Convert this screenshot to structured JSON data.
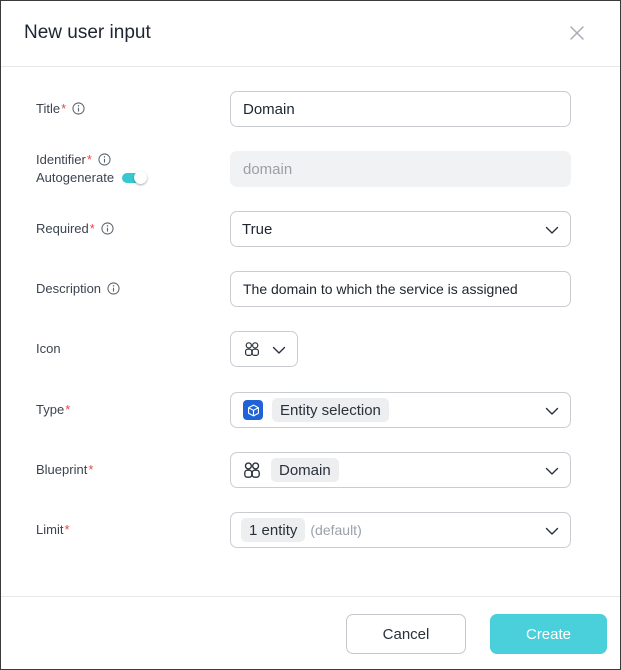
{
  "dialog": {
    "title": "New user input",
    "cancel_label": "Cancel",
    "create_label": "Create"
  },
  "fields": {
    "title": {
      "label": "Title",
      "required": "*",
      "value": "Domain"
    },
    "identifier": {
      "label": "Identifier",
      "required": "*",
      "autogenerate_label": "Autogenerate",
      "autogenerate_on": true,
      "placeholder": "domain"
    },
    "required": {
      "label": "Required",
      "required": "*",
      "value": "True"
    },
    "description": {
      "label": "Description",
      "value": "The domain to which the service is assigned"
    },
    "icon": {
      "label": "Icon",
      "icon_name": "domain-icon"
    },
    "type": {
      "label": "Type",
      "required": "*",
      "value": "Entity selection",
      "icon_name": "entity-cube-icon"
    },
    "blueprint": {
      "label": "Blueprint",
      "required": "*",
      "value": "Domain",
      "icon_name": "domain-icon"
    },
    "limit": {
      "label": "Limit",
      "required": "*",
      "value": "1 entity",
      "hint": "(default)"
    }
  },
  "colors": {
    "accent": "#49d0da",
    "toggle": "#39c8d1",
    "required": "#e5484d",
    "type_badge": "#1f63d6"
  }
}
